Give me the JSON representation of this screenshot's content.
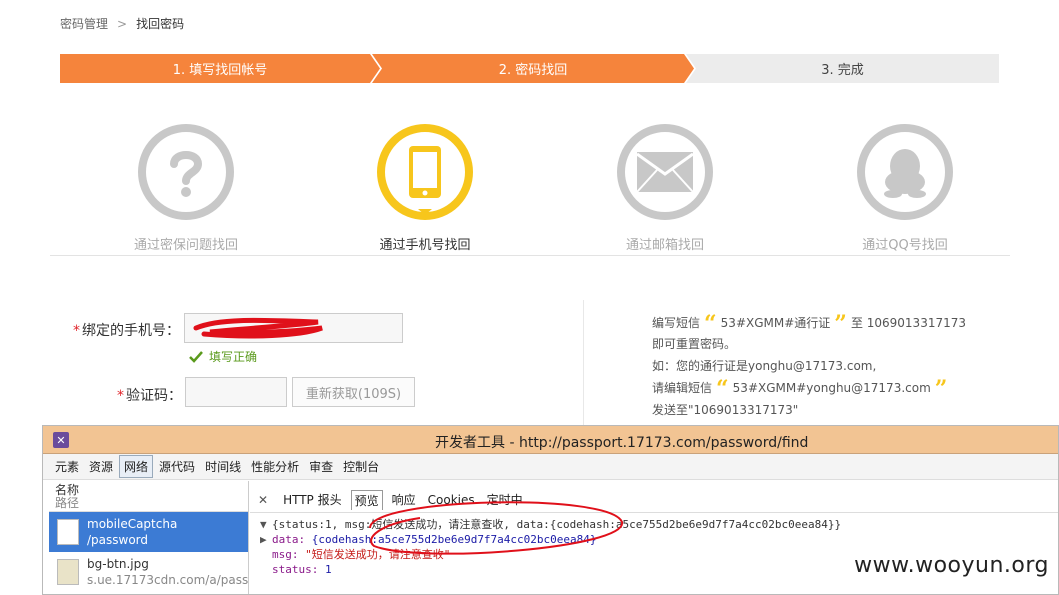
{
  "breadcrumb": {
    "parent": "密码管理",
    "separator": ">",
    "current": "找回密码"
  },
  "steps": [
    {
      "label": "1. 填写找回帐号",
      "state": "done"
    },
    {
      "label": "2. 密码找回",
      "state": "active"
    },
    {
      "label": "3. 完成",
      "state": "pending"
    }
  ],
  "methods": [
    {
      "label": "通过密保问题找回",
      "icon": "question-icon",
      "active": false
    },
    {
      "label": "通过手机号找回",
      "icon": "phone-icon",
      "active": true
    },
    {
      "label": "通过邮箱找回",
      "icon": "mail-icon",
      "active": false
    },
    {
      "label": "通过QQ号找回",
      "icon": "qq-icon",
      "active": false
    }
  ],
  "form": {
    "phone_label": "绑定的手机号：",
    "phone_ok": "填写正确",
    "code_label": "验证码：",
    "resend": "重新获取(109S)"
  },
  "sms_tip": {
    "line1_prefix": "编写短信",
    "line1_code": "53#XGMM#通行证",
    "line1_to": "至 1069013317173",
    "line2": "即可重置密码。",
    "line3": "如：您的通行证是yonghu@17173.com,",
    "line4_prefix": "请编辑短信",
    "line4_code": "53#XGMM#yonghu@17173.com",
    "line5": "发送至\"1069013317173\""
  },
  "devtools": {
    "title": "开发者工具 - http://passport.17173.com/password/find",
    "menu": [
      "元素",
      "资源",
      "网络",
      "源代码",
      "时间线",
      "性能分析",
      "审查",
      "控制台"
    ],
    "menu_selected": "网络",
    "list_header": {
      "name": "名称",
      "path": "路径"
    },
    "requests": [
      {
        "name": "mobileCaptcha",
        "path": "/password",
        "selected": true
      },
      {
        "name": "bg-btn.jpg",
        "path": "s.ue.17173cdn.com/a/pass|",
        "selected": false
      }
    ],
    "tabs": [
      "HTTP 报头",
      "预览",
      "响应",
      "Cookies",
      "定时中"
    ],
    "tab_selected": "预览",
    "preview": {
      "summary": "{status:1, msg:短信发送成功，请注意查收, data:{codehash:a5ce755d2be6e9d7f7a4cc02bc0eea84}}",
      "data_key": "data:",
      "data_val": "{codehash:a5ce755d2be6e9d7f7a4cc02bc0eea84}",
      "msg_key": "msg:",
      "msg_val": "\"短信发送成功，请注意查收\"",
      "status_key": "status:",
      "status_val": "1"
    }
  },
  "watermark": "www.wooyun.org",
  "colors": {
    "orange": "#f5843c",
    "yellow": "#f7c61c",
    "gray_icon": "#c8c8c8",
    "annotation_red": "#e0101a"
  }
}
